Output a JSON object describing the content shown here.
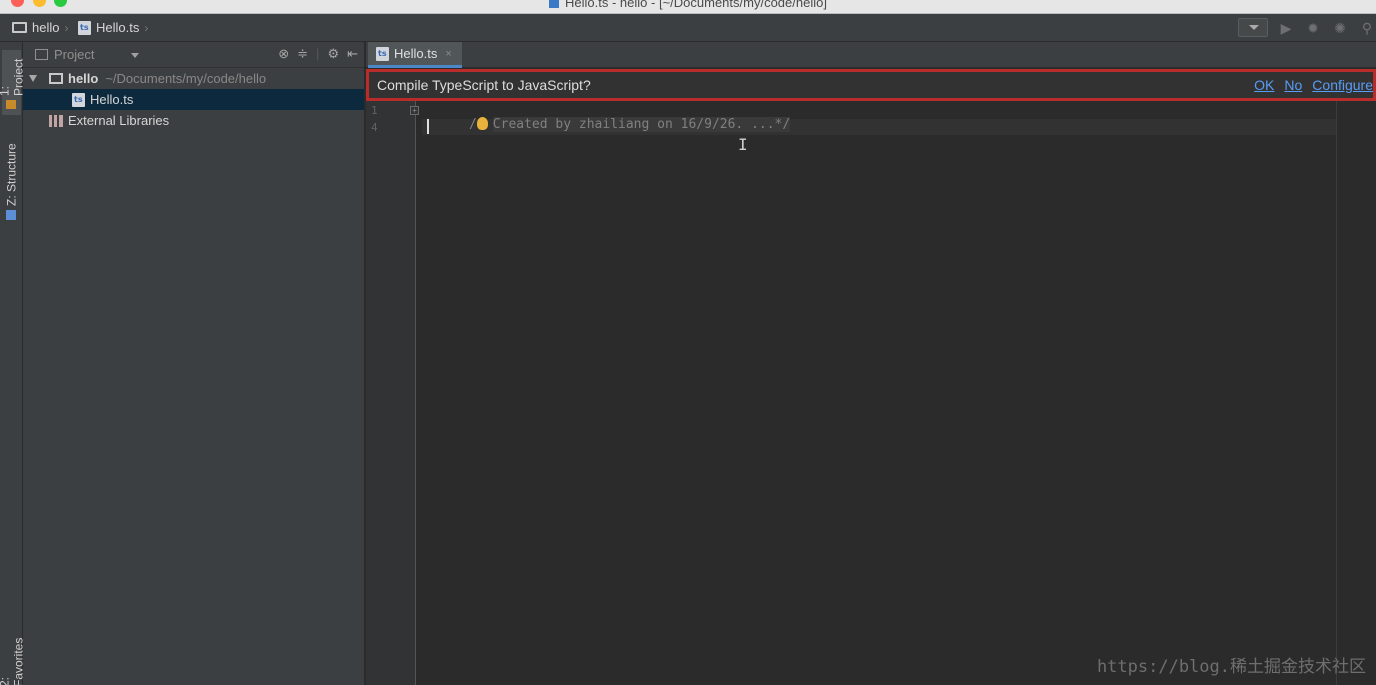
{
  "window": {
    "title": "Hello.ts - hello - [~/Documents/my/code/hello]"
  },
  "navbar": {
    "project": "hello",
    "file": "Hello.ts"
  },
  "sidebar_tabs": {
    "project": "1: Project",
    "structure": "Z: Structure",
    "favorites": "2: Favorites"
  },
  "project_panel": {
    "title": "Project",
    "tree": [
      {
        "label": "hello",
        "hint": "~/Documents/my/code/hello",
        "type": "folder",
        "expanded": true
      },
      {
        "label": "Hello.ts",
        "type": "file",
        "selected": true
      },
      {
        "label": "External Libraries",
        "type": "libraries"
      }
    ]
  },
  "editor": {
    "tab_label": "Hello.ts",
    "tab_close": "×",
    "notification": {
      "text": "Compile TypeScript to JavaScript?",
      "actions": [
        "OK",
        "No",
        "Configure"
      ]
    },
    "lines": [
      {
        "number": "1",
        "text": "Created by zhailiang on 16/9/26. ...*/",
        "prefix": "/"
      },
      {
        "number": "4",
        "text": ""
      }
    ]
  },
  "watermark": "https://blog.稀土掘金技术社区",
  "colors": {
    "accent_link": "#589df6",
    "highlight_border": "#b82c2c",
    "selection": "#0d293e"
  }
}
